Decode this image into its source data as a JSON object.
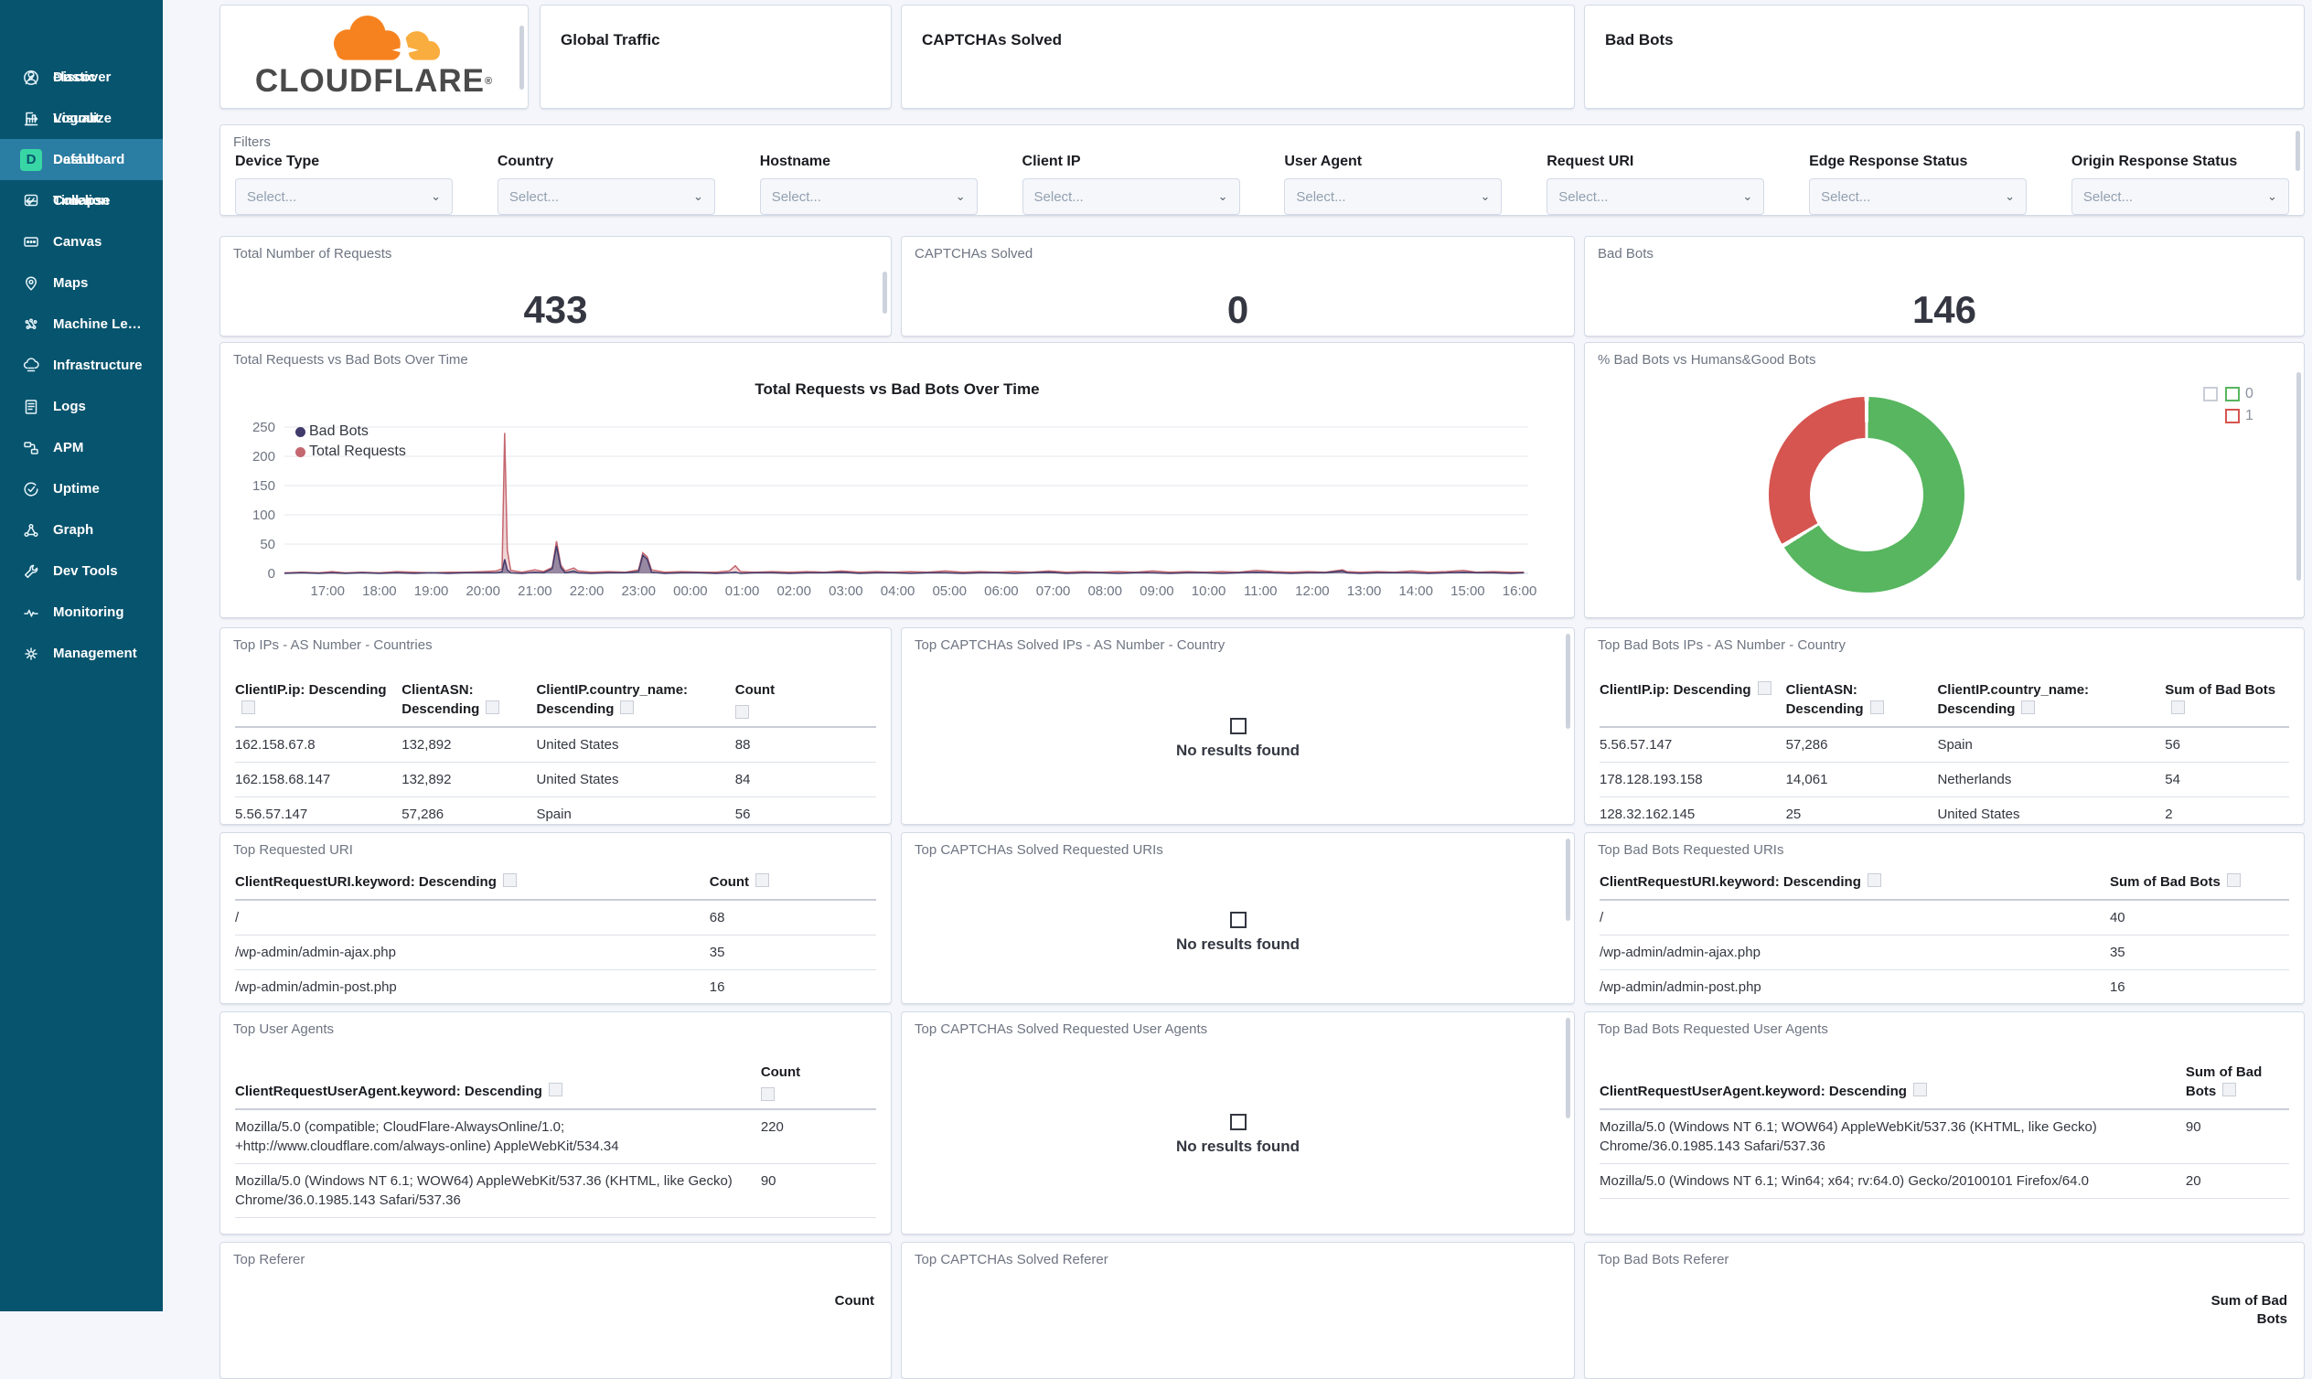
{
  "colors": {
    "sidebar_bg": "#07546E",
    "sidebar_active": "#2A7DA3",
    "space_badge": "#38D6A5",
    "panel_border": "#D3DAE6",
    "panel_title": "#6E7582",
    "text": "#343741",
    "cloudflare_orange": "#F6821F",
    "cloudflare_light_orange": "#FAAD3F",
    "donut_green": "#57B65F",
    "donut_red": "#D65550",
    "line_total_requests": "#C4676F",
    "line_bad_bots": "#413B6B"
  },
  "sidebar": {
    "items": [
      {
        "label": "Discover",
        "icon": "discover-icon",
        "active": false
      },
      {
        "label": "Visualize",
        "icon": "visualize-icon",
        "active": false
      },
      {
        "label": "Dashboard",
        "icon": "dashboard-icon",
        "active": true
      },
      {
        "label": "Timelion",
        "icon": "timelion-icon",
        "active": false
      },
      {
        "label": "Canvas",
        "icon": "canvas-icon",
        "active": false
      },
      {
        "label": "Maps",
        "icon": "maps-icon",
        "active": false
      },
      {
        "label": "Machine Le…",
        "icon": "machine-learning-icon",
        "active": false
      },
      {
        "label": "Infrastructure",
        "icon": "infrastructure-icon",
        "active": false
      },
      {
        "label": "Logs",
        "icon": "logs-icon",
        "active": false
      },
      {
        "label": "APM",
        "icon": "apm-icon",
        "active": false
      },
      {
        "label": "Uptime",
        "icon": "uptime-icon",
        "active": false
      },
      {
        "label": "Graph",
        "icon": "graph-icon",
        "active": false
      },
      {
        "label": "Dev Tools",
        "icon": "devtools-icon",
        "active": false
      },
      {
        "label": "Monitoring",
        "icon": "monitoring-icon",
        "active": false
      },
      {
        "label": "Management",
        "icon": "management-icon",
        "active": false
      }
    ],
    "footer": [
      {
        "label": "elastic",
        "icon": "user-icon"
      },
      {
        "label": "Logout",
        "icon": "logout-icon"
      },
      {
        "label": "Default",
        "icon": "space-badge",
        "badge": "D"
      },
      {
        "label": "Collapse",
        "icon": "collapse-icon"
      }
    ]
  },
  "header_cards": {
    "brand": "CLOUDFLARE",
    "brand_mark": "®",
    "global_traffic": "Global Traffic",
    "captchas_solved": "CAPTCHAs Solved",
    "bad_bots": "Bad Bots"
  },
  "filters": {
    "panel_label": "Filters",
    "fields": [
      {
        "label": "Device Type",
        "placeholder": "Select..."
      },
      {
        "label": "Country",
        "placeholder": "Select..."
      },
      {
        "label": "Hostname",
        "placeholder": "Select..."
      },
      {
        "label": "Client IP",
        "placeholder": "Select..."
      },
      {
        "label": "User Agent",
        "placeholder": "Select..."
      },
      {
        "label": "Request URI",
        "placeholder": "Select..."
      },
      {
        "label": "Edge Response Status",
        "placeholder": "Select..."
      },
      {
        "label": "Origin Response Status",
        "placeholder": "Select..."
      }
    ]
  },
  "metrics": [
    {
      "title": "Total Number of Requests",
      "value": "433"
    },
    {
      "title": "CAPTCHAs Solved",
      "value": "0"
    },
    {
      "title": "Bad Bots",
      "value": "146"
    }
  ],
  "chart_data": [
    {
      "type": "line",
      "panel_title": "Total Requests vs Bad Bots Over Time",
      "title": "Total Requests vs Bad Bots Over Time",
      "ylabel": "",
      "xlabel": "",
      "ylim": [
        0,
        250
      ],
      "y_ticks": [
        0,
        50,
        100,
        150,
        200,
        250
      ],
      "grid": true,
      "legend_position": "top-left",
      "x_tick_labels": [
        "17:00",
        "18:00",
        "19:00",
        "20:00",
        "21:00",
        "22:00",
        "23:00",
        "00:00",
        "01:00",
        "02:00",
        "03:00",
        "04:00",
        "05:00",
        "06:00",
        "07:00",
        "08:00",
        "09:00",
        "10:00",
        "11:00",
        "12:00",
        "13:00",
        "14:00",
        "15:00",
        "16:00"
      ],
      "x_tick_minutes": [
        50,
        110,
        170,
        230,
        290,
        350,
        410,
        470,
        530,
        590,
        650,
        710,
        770,
        830,
        890,
        950,
        1010,
        1070,
        1130,
        1190,
        1250,
        1310,
        1370,
        1430
      ],
      "time_span_minutes": 1440,
      "x_minutes": [
        0,
        20,
        40,
        55,
        70,
        90,
        110,
        130,
        150,
        170,
        190,
        210,
        230,
        245,
        252,
        255,
        258,
        262,
        275,
        290,
        300,
        310,
        315,
        320,
        325,
        335,
        340,
        355,
        375,
        395,
        410,
        415,
        420,
        425,
        440,
        460,
        480,
        500,
        515,
        522,
        528,
        545,
        565,
        585,
        605,
        625,
        645,
        665,
        685,
        705,
        725,
        745,
        765,
        785,
        805,
        825,
        845,
        865,
        885,
        905,
        925,
        945,
        965,
        985,
        1005,
        1025,
        1045,
        1065,
        1085,
        1105,
        1125,
        1145,
        1165,
        1185,
        1205,
        1225,
        1230,
        1245,
        1265,
        1285,
        1305,
        1325,
        1345,
        1365,
        1380,
        1400,
        1420,
        1435
      ],
      "series": [
        {
          "name": "Total Requests",
          "color": "#C4676F",
          "fill": "rgba(196,103,111,0.28)",
          "values": [
            1,
            2,
            1,
            3,
            1,
            2,
            1,
            3,
            2,
            1,
            2,
            2,
            3,
            4,
            8,
            240,
            40,
            5,
            2,
            6,
            3,
            10,
            55,
            14,
            4,
            9,
            4,
            2,
            3,
            2,
            6,
            35,
            28,
            6,
            2,
            3,
            2,
            2,
            4,
            13,
            3,
            2,
            3,
            2,
            3,
            2,
            4,
            2,
            3,
            2,
            3,
            2,
            4,
            2,
            3,
            2,
            3,
            2,
            4,
            2,
            3,
            2,
            3,
            2,
            4,
            2,
            3,
            2,
            3,
            2,
            5,
            3,
            2,
            3,
            2,
            6,
            3,
            2,
            3,
            2,
            4,
            2,
            3,
            5,
            2,
            3,
            2,
            2
          ]
        },
        {
          "name": "Bad Bots",
          "color": "#413B6B",
          "fill": "rgba(65,59,107,0.5)",
          "values": [
            0,
            1,
            0,
            1,
            0,
            1,
            0,
            1,
            0,
            1,
            0,
            1,
            1,
            1,
            3,
            24,
            6,
            1,
            0,
            2,
            1,
            8,
            47,
            10,
            1,
            4,
            1,
            0,
            1,
            1,
            3,
            31,
            24,
            2,
            0,
            1,
            1,
            0,
            1,
            2,
            0,
            1,
            1,
            0,
            1,
            1,
            2,
            0,
            1,
            1,
            0,
            1,
            1,
            0,
            1,
            1,
            0,
            1,
            2,
            0,
            1,
            1,
            0,
            1,
            1,
            0,
            1,
            1,
            0,
            1,
            2,
            1,
            0,
            1,
            1,
            4,
            1,
            0,
            1,
            1,
            1,
            0,
            1,
            2,
            1,
            1,
            0,
            1
          ]
        }
      ],
      "legend_order": [
        "Bad Bots",
        "Total Requests"
      ]
    },
    {
      "type": "donut",
      "panel_title": "% Bad Bots vs Humans&Good Bots",
      "legend_position": "top-right",
      "total": 433,
      "segments": [
        {
          "label": "0",
          "value": 287,
          "color": "#57B65F"
        },
        {
          "label": "1",
          "value": 146,
          "color": "#D65550"
        }
      ]
    }
  ],
  "tables": {
    "top_ips": {
      "title": "Top IPs - AS Number - Countries",
      "columns": [
        "ClientIP.ip: Descending",
        "ClientASN: Descending",
        "ClientIP.country_name: Descending",
        "Count"
      ],
      "rows": [
        [
          "162.158.67.8",
          "132,892",
          "United States",
          "88"
        ],
        [
          "162.158.68.147",
          "132,892",
          "United States",
          "84"
        ],
        [
          "5.56.57.147",
          "57,286",
          "Spain",
          "56"
        ]
      ]
    },
    "captcha_ips": {
      "title": "Top CAPTCHAs Solved IPs - AS Number - Country"
    },
    "badbot_ips": {
      "title": "Top Bad Bots IPs - AS Number - Country",
      "columns": [
        "ClientIP.ip: Descending",
        "ClientASN: Descending",
        "ClientIP.country_name: Descending",
        "Sum of Bad Bots"
      ],
      "rows": [
        [
          "5.56.57.147",
          "57,286",
          "Spain",
          "56"
        ],
        [
          "178.128.193.158",
          "14,061",
          "Netherlands",
          "54"
        ],
        [
          "128.32.162.145",
          "25",
          "United States",
          "2"
        ]
      ]
    },
    "top_uri": {
      "title": "Top Requested URI",
      "columns": [
        "ClientRequestURI.keyword: Descending",
        "Count"
      ],
      "rows": [
        [
          "/",
          "68"
        ],
        [
          "/wp-admin/admin-ajax.php",
          "35"
        ],
        [
          "/wp-admin/admin-post.php",
          "16"
        ]
      ]
    },
    "captcha_uri": {
      "title": "Top CAPTCHAs Solved Requested URIs"
    },
    "badbot_uri": {
      "title": "Top Bad Bots Requested URIs",
      "columns": [
        "ClientRequestURI.keyword: Descending",
        "Sum of Bad Bots"
      ],
      "rows": [
        [
          "/",
          "40"
        ],
        [
          "/wp-admin/admin-ajax.php",
          "35"
        ],
        [
          "/wp-admin/admin-post.php",
          "16"
        ]
      ]
    },
    "top_ua": {
      "title": "Top User Agents",
      "columns": [
        "ClientRequestUserAgent.keyword: Descending",
        "Count"
      ],
      "rows": [
        [
          "Mozilla/5.0 (compatible; CloudFlare-AlwaysOnline/1.0; +http://www.cloudflare.com/always-online) AppleWebKit/534.34",
          "220"
        ],
        [
          "Mozilla/5.0 (Windows NT 6.1; WOW64) AppleWebKit/537.36 (KHTML, like Gecko) Chrome/36.0.1985.143 Safari/537.36",
          "90"
        ]
      ]
    },
    "captcha_ua": {
      "title": "Top CAPTCHAs Solved Requested User Agents"
    },
    "badbot_ua": {
      "title": "Top Bad Bots Requested User Agents",
      "columns": [
        "ClientRequestUserAgent.keyword: Descending",
        "Sum of Bad Bots"
      ],
      "rows": [
        [
          "Mozilla/5.0 (Windows NT 6.1; WOW64) AppleWebKit/537.36 (KHTML, like Gecko) Chrome/36.0.1985.143 Safari/537.36",
          "90"
        ],
        [
          "Mozilla/5.0 (Windows NT 6.1; Win64; x64; rv:64.0) Gecko/20100101 Firefox/64.0",
          "20"
        ]
      ]
    }
  },
  "referers": [
    {
      "title": "Top Referer",
      "col_label": "Count"
    },
    {
      "title": "Top CAPTCHAs Solved Referer",
      "col_label": ""
    },
    {
      "title": "Top Bad Bots Referer",
      "col_label": "Sum of Bad Bots"
    }
  ],
  "empty_state": {
    "icon": "table-icon",
    "label": "No results found"
  }
}
